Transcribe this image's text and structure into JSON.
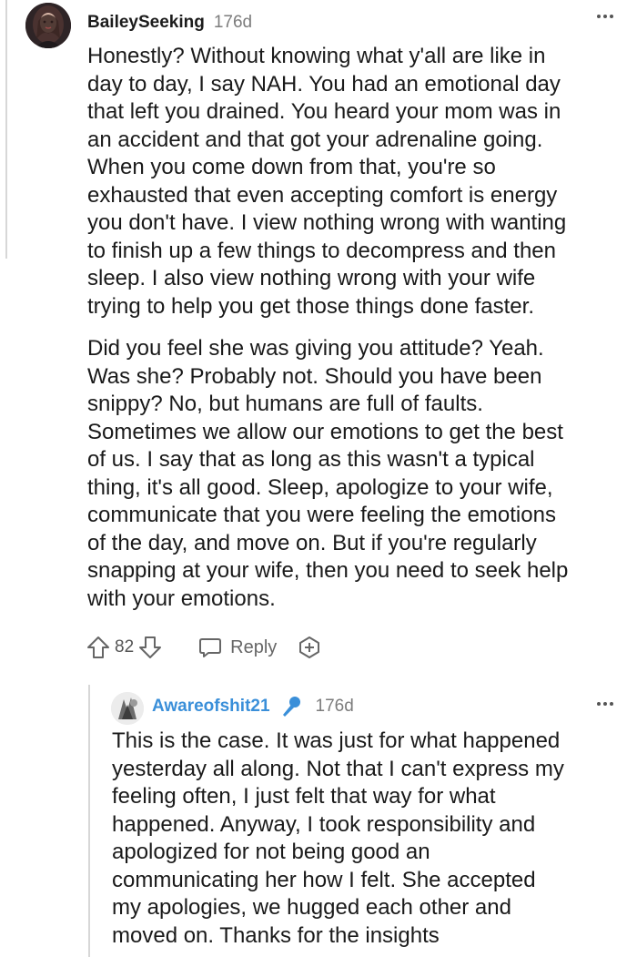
{
  "comment": {
    "username": "BaileySeeking",
    "time": "176d",
    "paragraphs": [
      "Honestly? Without knowing what y'all are like in\nday to day, I say NAH. You had an emotional day\nthat left you drained. You heard your mom was in\nan accident and that got your adrenaline going.\nWhen you come down from that, you're so\nexhausted that even accepting comfort is energy\nyou don't have. I view nothing wrong with wanting\nto finish up a few things to decompress and then\nsleep. I also view nothing wrong with your wife\ntrying to help you get those things done faster.",
      "Did you feel she was giving you attitude? Yeah.\nWas she? Probably not. Should you have been\nsnippy? No, but humans are full of faults.\nSometimes we allow our emotions to get the best\nof us. I say that as long as this wasn't a typical\nthing, it's all good. Sleep, apologize to your wife,\ncommunicate that you were feeling the emotions\nof the day, and move on. But if you're regularly\nsnapping at your wife, then you need to seek help\nwith your emotions."
    ],
    "votes": "82",
    "reply_label": "Reply",
    "icons": [
      "avatar",
      "more-options-icon",
      "upvote-icon",
      "downvote-icon",
      "reply-bubble-icon",
      "award-plus-icon"
    ]
  },
  "reply": {
    "username": "Awareofshit21",
    "time": "176d",
    "body": "This is the case. It was just for what happened\nyesterday all along. Not that I can't express my\nfeeling often, I just felt that way for what\nhappened. Anyway, I took responsibility and\napologized for not being good an\ncommunicating her how I felt. She accepted\nmy apologies, we hugged each other and\nmoved on. Thanks for the insights",
    "icons": [
      "avatar",
      "microphone-badge-icon",
      "more-options-icon"
    ]
  },
  "colors": {
    "reply_username": "#3a8fd9",
    "muted_text": "#7c7c7c",
    "thread_line": "#d7d7d7"
  }
}
